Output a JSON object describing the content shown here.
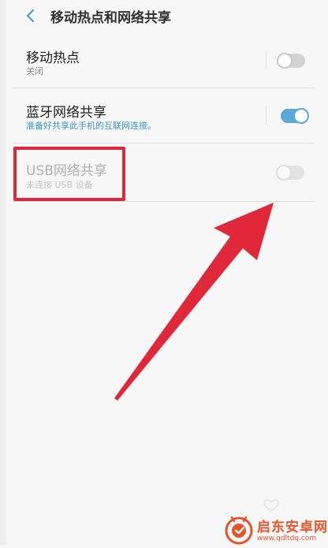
{
  "header": {
    "title": "移动热点和网络共享"
  },
  "settings": [
    {
      "title": "移动热点",
      "subtitle": "关闭",
      "toggle_state": "off"
    },
    {
      "title": "蓝牙网络共享",
      "subtitle": "准备好共享此手机的互联网连接。",
      "toggle_state": "on"
    },
    {
      "title": "USB网络共享",
      "subtitle": "未连接 USB 设备",
      "toggle_state": "disabled"
    }
  ],
  "annotation": {
    "color": "#e0283a"
  },
  "colors": {
    "accent": "#5aa8d8",
    "highlight": "#e0283a",
    "background": "#f7f7f7"
  },
  "watermark": {
    "name": "启东安卓网",
    "url": "www.qdltdq.com"
  }
}
